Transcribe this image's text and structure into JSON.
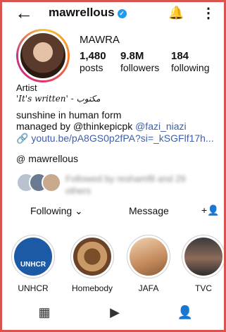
{
  "header": {
    "username": "mawrellous",
    "verified_glyph": "✓",
    "icons": {
      "back": "back-arrow-icon",
      "bell": "bell-icon",
      "more": "more-vertical-icon"
    }
  },
  "profile": {
    "display_name": "MAWRA",
    "stats": [
      {
        "value": "1,480",
        "label": "posts"
      },
      {
        "value": "9.8M",
        "label": "followers"
      },
      {
        "value": "184",
        "label": "following"
      }
    ],
    "category": "Artist",
    "quote": "'It's written' - مكتوب",
    "bio_line1": "sunshine in human form",
    "bio_line2_prefix": "managed by @thinkepicpk ",
    "bio_line2_mention": "@fazi_niazi",
    "link": "youtu.be/pA8GS0p2fPA?si=_kSGFlf17h...",
    "threads_handle": "mawrellous"
  },
  "followed_by": {
    "text": "Followed by reshamf8 and 29 others"
  },
  "actions": {
    "following_label": "Following",
    "message_label": "Message"
  },
  "highlights": [
    {
      "label": "UNHCR",
      "inner_text": "UNHCR"
    },
    {
      "label": "Homebody"
    },
    {
      "label": "JAFA"
    },
    {
      "label": "TVC"
    }
  ],
  "colors": {
    "accent_link": "#3e5fa8",
    "verified": "#1d9bf0",
    "frame_border": "#d9534f"
  }
}
